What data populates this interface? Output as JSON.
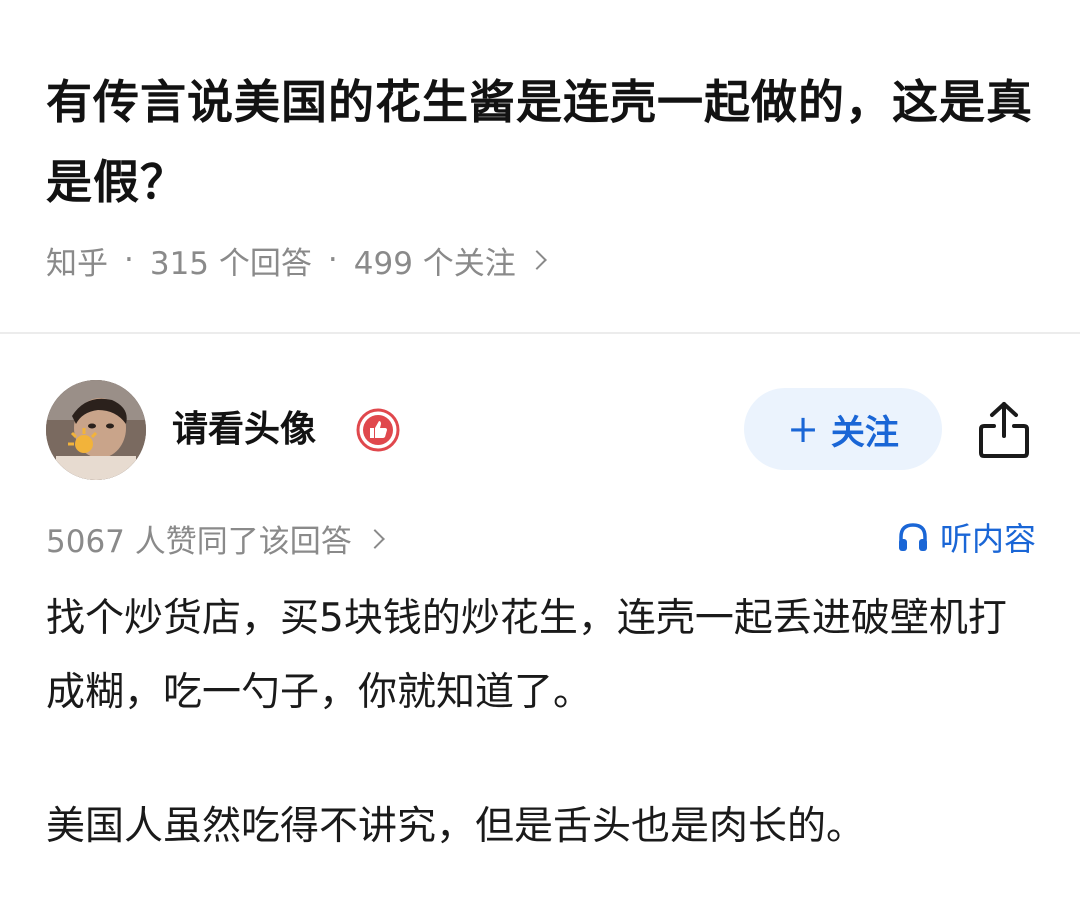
{
  "question": {
    "title": "有传言说美国的花生酱是连壳一起做的，这是真是假？",
    "source": "知乎",
    "answer_count": "315 个回答",
    "follower_count": "499 个关注",
    "separator": "·"
  },
  "author": {
    "name": "请看头像",
    "follow_label": "关注",
    "follow_prefix": "+"
  },
  "stats": {
    "likes": "5067 人赞同了该回答",
    "listen_label": "听内容"
  },
  "answer": {
    "paragraphs": [
      "找个炒货店，买5块钱的炒花生，连壳一起丢进破壁机打成糊，吃一勺子，你就知道了。",
      "美国人虽然吃得不讲究，但是舌头也是肉长的。"
    ]
  },
  "colors": {
    "accent": "#1a66d6",
    "follow_bg": "#ebf3fd",
    "meta_gray": "#8a8a8a",
    "badge_red": "#e0484d"
  },
  "icons": {
    "badge": "thumbs-up-badge-icon",
    "share": "share-icon",
    "listen": "headphones-icon",
    "chevron": "chevron-right-icon"
  }
}
